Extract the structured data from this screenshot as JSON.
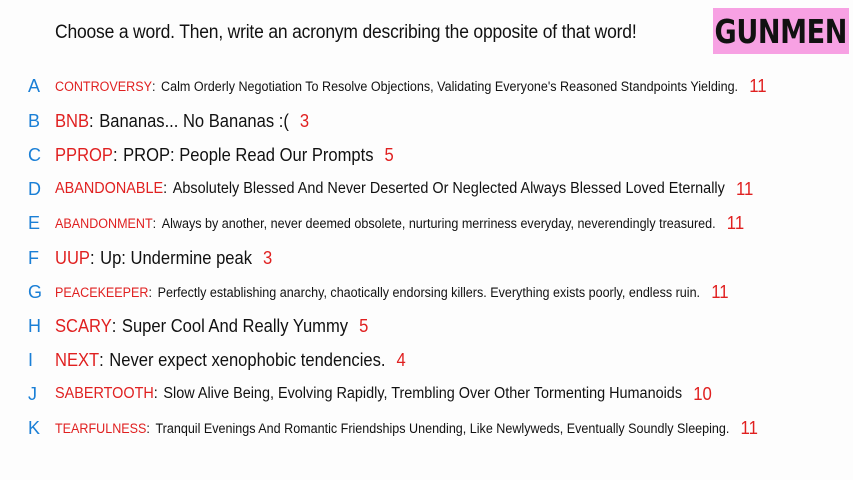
{
  "header": {
    "prompt": "Choose a word. Then, write an acronym describing the opposite of that word!",
    "brand": "GUNMEN"
  },
  "rows": [
    {
      "letter": "A",
      "word": "CONTROVERSY",
      "acronym": "Calm Orderly Negotiation To Resolve Objections, Validating Everyone's Reasoned Standpoints Yielding.",
      "count": "11"
    },
    {
      "letter": "B",
      "word": "BNB",
      "acronym": "Bananas... No Bananas :(",
      "count": "3"
    },
    {
      "letter": "C",
      "word": "PPROP",
      "acronym": "PROP: People Read Our Prompts",
      "count": "5"
    },
    {
      "letter": "D",
      "word": "ABANDONABLE",
      "acronym": "Absolutely Blessed And Never Deserted Or Neglected Always Blessed Loved Eternally",
      "count": "11"
    },
    {
      "letter": "E",
      "word": "ABANDONMENT",
      "acronym": "Always by another, never deemed obsolete, nurturing merriness everyday, neverendingly treasured.",
      "count": "11"
    },
    {
      "letter": "F",
      "word": "UUP",
      "acronym": "Up: Undermine peak",
      "count": "3"
    },
    {
      "letter": "G",
      "word": "PEACEKEEPER",
      "acronym": "Perfectly establishing anarchy, chaotically endorsing killers. Everything exists poorly, endless ruin.",
      "count": "11"
    },
    {
      "letter": "H",
      "word": "SCARY",
      "acronym": "Super Cool And Really Yummy",
      "count": "5"
    },
    {
      "letter": "I",
      "word": "NEXT",
      "acronym": "Never expect xenophobic tendencies.",
      "count": "4"
    },
    {
      "letter": "J",
      "word": "SABERTOOTH",
      "acronym": "Slow Alive Being, Evolving Rapidly, Trembling Over Other Tormenting Humanoids",
      "count": "10"
    },
    {
      "letter": "K",
      "word": "TEARFULNESS",
      "acronym": "Tranquil Evenings And Romantic Friendships Unending, Like Newlyweds, Eventually Soundly Sleeping.",
      "count": "11"
    }
  ],
  "colors": {
    "letter": "#1a7fd6",
    "word": "#e02020",
    "count": "#e02020",
    "brand_bg": "#f7a1e3",
    "text": "#111111"
  }
}
